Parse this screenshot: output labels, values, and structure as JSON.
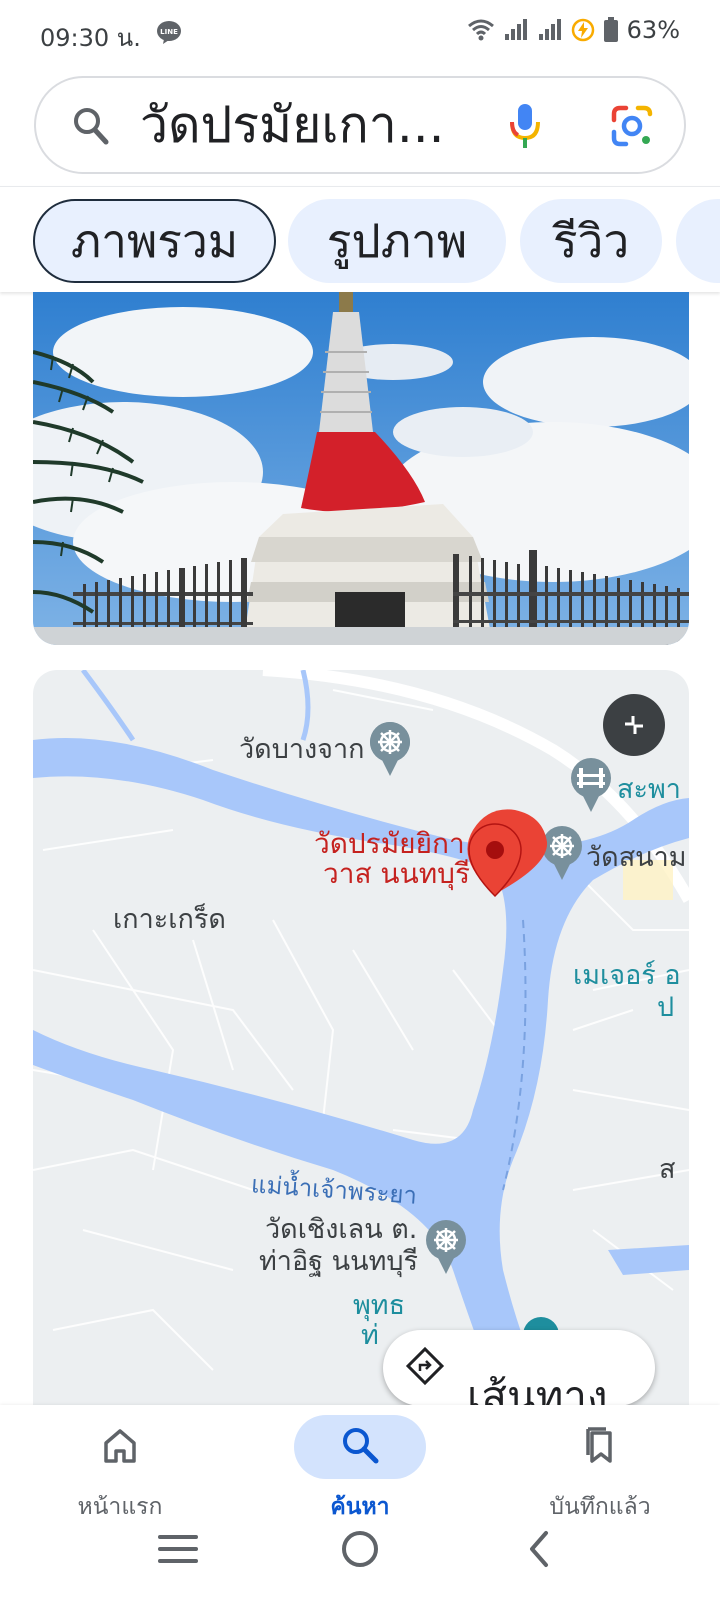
{
  "status_bar": {
    "time": "09:30 น.",
    "battery": "63%",
    "icons": [
      "line-app-icon",
      "wifi-icon",
      "signal-icon",
      "signal-icon",
      "charging-icon",
      "battery-icon"
    ]
  },
  "search": {
    "query": "วัดปรมัยเกา...",
    "icons": [
      "search-icon",
      "mic-icon",
      "lens-icon"
    ]
  },
  "chips": [
    "ภาพรวม",
    "รูปภาพ",
    "รีวิว"
  ],
  "map": {
    "places": {
      "wat_bang_chak": "วัดบางจาก",
      "bridge": "สะพา",
      "wat_sanam": "วัดสนาม",
      "koh_kret": "เกาะเกร็ด",
      "major": "เมเจอร์ อ",
      "major_2": "ป",
      "river": "แม่น้ำเจ้าพระยา",
      "wat_choeng_len_1": "วัดเชิงเลน ต.",
      "wat_choeng_len_2": "ท่าอิฐ นนทบุรี",
      "buddha_1": "พุทธ",
      "buddha_2": "ท่",
      "edge_s": "ส"
    },
    "pin_label_1": "วัดปรมัยยิกา",
    "pin_label_2": "วาส นนทบุรี",
    "directions_label": "เส้นทาง"
  },
  "bottom_nav": [
    {
      "label": "หน้าแรก",
      "icon": "home-icon"
    },
    {
      "label": "ค้นหา",
      "icon": "search-icon"
    },
    {
      "label": "บันทึกแล้ว",
      "icon": "saved-icon"
    }
  ],
  "colors": {
    "accent": "#0b57d0",
    "chip_bg": "#e8f0fe",
    "river": "#a8c7fa",
    "pin": "#ea4335",
    "pin_label": "#c5221f"
  }
}
